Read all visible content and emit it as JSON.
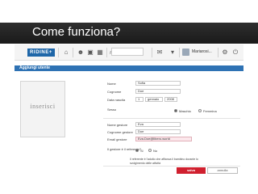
{
  "slide": {
    "title": "Come funziona?"
  },
  "app": {
    "logo": "RIDINE+",
    "user_name": "Mariarosi...",
    "section_title": "Aggiungi utente",
    "photo_placeholder": "inserisci",
    "form": {
      "nome_label": "Nome",
      "nome_value": "Sofia",
      "cognome_label": "Cognome",
      "cognome_value": "Doe",
      "data_nascita_label": "Data nascita",
      "giorno_value": "1",
      "mese_value": "gennaio",
      "anno_value": "2008",
      "sesso_label": "Sesso",
      "sesso_maschio": "Maschio",
      "sesso_femmina": "Femmina",
      "nome_gestore_label": "Nome gestore",
      "nome_gestore_value": "Eva",
      "cognome_gestore_label": "Cognome gestore",
      "cognome_gestore_value": "Doe",
      "email_gestore_label": "Email gestore",
      "email_gestore_value": "Eva.Doe@libero.world",
      "referente_label": "Il gestore è il referente?",
      "referente_si": "Si",
      "referente_no": "No",
      "note": "Il referente è l'adulto che affianca il bambino durante lo svolgimento delle attività"
    },
    "buttons": {
      "save": "salva",
      "cancel": "annulla"
    }
  }
}
